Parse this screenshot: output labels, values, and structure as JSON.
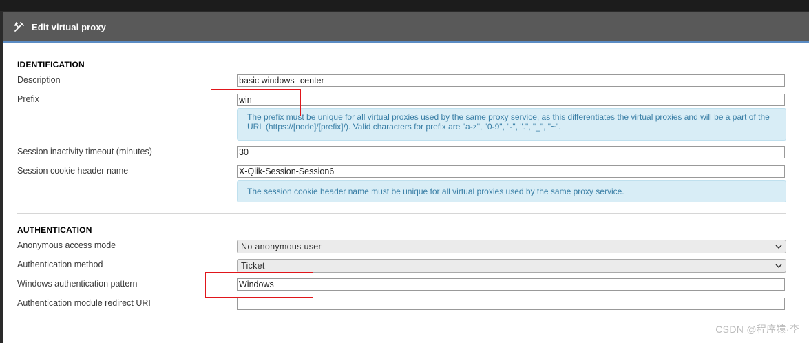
{
  "dialog": {
    "title": "Edit virtual proxy",
    "title_icon": "edit-icon"
  },
  "identification": {
    "heading": "IDENTIFICATION",
    "description": {
      "label": "Description",
      "value": "basic windows--center"
    },
    "prefix": {
      "label": "Prefix",
      "value": "win",
      "help": "The prefix must be unique for all virtual proxies used by the same proxy service, as this differentiates the virtual proxies and will be a part of the URL (https://[node]/[prefix]/). Valid characters for prefix are \"a-z\", \"0-9\", \"-\", \".\", \"_\", \"~\"."
    },
    "session_timeout": {
      "label": "Session inactivity timeout (minutes)",
      "value": "30"
    },
    "cookie_header": {
      "label": "Session cookie header name",
      "value": "X-Qlik-Session-Session6",
      "help": "The session cookie header name must be unique for all virtual proxies used by the same proxy service."
    }
  },
  "authentication": {
    "heading": "AUTHENTICATION",
    "anonymous_mode": {
      "label": "Anonymous access mode",
      "value": "No anonymous user"
    },
    "auth_method": {
      "label": "Authentication method",
      "value": "Ticket"
    },
    "windows_pattern": {
      "label": "Windows authentication pattern",
      "value": "Windows"
    },
    "redirect_uri": {
      "label": "Authentication module redirect URI",
      "value": ""
    }
  },
  "watermark": "CSDN @程序猿·李",
  "colors": {
    "titlebar": "#595959",
    "accent": "#5b8cc4",
    "info_bg": "#d8edf6",
    "info_text": "#3a7fa6",
    "highlight": "#e0161b"
  }
}
